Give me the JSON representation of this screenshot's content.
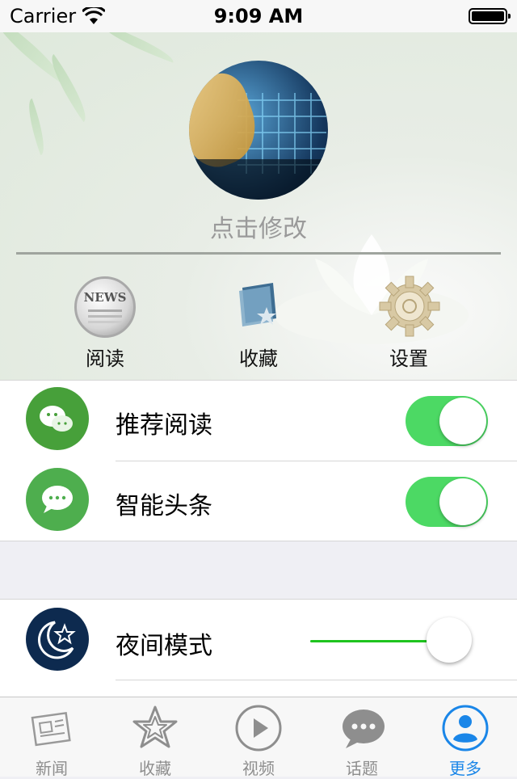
{
  "status_bar": {
    "carrier": "Carrier",
    "time": "9:09 AM",
    "wifi_icon": "wifi-icon",
    "battery_icon": "battery-icon"
  },
  "profile": {
    "avatar_icon": "avatar-image",
    "edit_label": "点击修改"
  },
  "quick_actions": [
    {
      "label": "阅读",
      "icon": "news-icon"
    },
    {
      "label": "收藏",
      "icon": "star-folder-icon"
    },
    {
      "label": "设置",
      "icon": "gear-icon"
    }
  ],
  "settings_group_1": [
    {
      "label": "推荐阅读",
      "icon": "wechat-icon",
      "icon_color": "#47a03a",
      "toggle_on": true
    },
    {
      "label": "智能头条",
      "icon": "chat-bubble-icon",
      "icon_color": "#4eae4e",
      "toggle_on": true
    }
  ],
  "settings_group_2": [
    {
      "label": "夜间模式",
      "icon": "moon-star-icon",
      "icon_color": "#0d2a4f",
      "slider_value": 0.9
    }
  ],
  "tab_bar": {
    "active_color": "#1a86e8",
    "items": [
      {
        "label": "新闻",
        "icon": "newspaper-icon",
        "active": false
      },
      {
        "label": "收藏",
        "icon": "star-icon",
        "active": false
      },
      {
        "label": "视频",
        "icon": "play-icon",
        "active": false
      },
      {
        "label": "话题",
        "icon": "chat-icon",
        "active": false
      },
      {
        "label": "更多",
        "icon": "person-icon",
        "active": true
      }
    ]
  },
  "colors": {
    "toggle_on": "#4cd964",
    "slider_fill": "#1ec41e"
  }
}
